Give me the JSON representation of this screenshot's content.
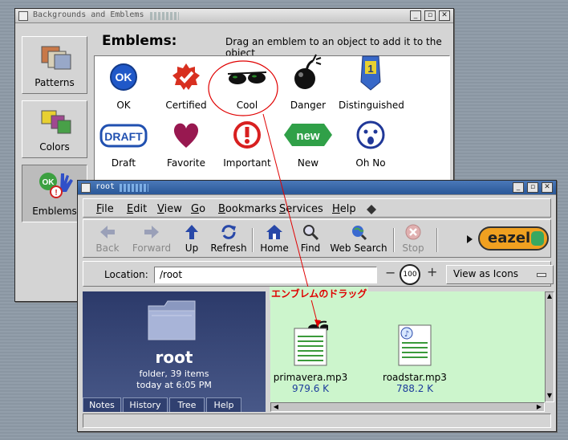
{
  "bg_window": {
    "title": "Backgrounds and Emblems",
    "header_title": "Emblems:",
    "header_hint": "Drag an emblem to an object to add it to the object",
    "sidebar": [
      {
        "label": "Patterns",
        "icon": "patterns-icon"
      },
      {
        "label": "Colors",
        "icon": "colors-icon"
      },
      {
        "label": "Emblems",
        "icon": "emblems-icon"
      }
    ],
    "emblems": [
      {
        "label": "OK",
        "icon": "ok-icon"
      },
      {
        "label": "Certified",
        "icon": "certified-icon"
      },
      {
        "label": "Cool",
        "icon": "sunglasses-icon"
      },
      {
        "label": "Danger",
        "icon": "bomb-icon"
      },
      {
        "label": "Distinguished",
        "icon": "ribbon-icon"
      },
      {
        "label": "Draft",
        "icon": "draft-icon"
      },
      {
        "label": "Favorite",
        "icon": "heart-icon"
      },
      {
        "label": "Important",
        "icon": "important-icon"
      },
      {
        "label": "New",
        "icon": "new-icon"
      },
      {
        "label": "Oh No",
        "icon": "oh-no-icon"
      }
    ]
  },
  "root_window": {
    "title": "root",
    "menu": [
      "File",
      "Edit",
      "View",
      "Go",
      "Bookmarks",
      "Services",
      "Help"
    ],
    "menu_underline": [
      "F",
      "E",
      "V",
      "G",
      "B",
      "S",
      "H"
    ],
    "toolbar": [
      {
        "label": "Back",
        "icon": "back-arrow-icon",
        "enabled": false
      },
      {
        "label": "Forward",
        "icon": "forward-arrow-icon",
        "enabled": false
      },
      {
        "label": "Up",
        "icon": "up-arrow-icon",
        "enabled": true
      },
      {
        "label": "Refresh",
        "icon": "refresh-icon",
        "enabled": true
      },
      {
        "label": "Home",
        "icon": "home-icon",
        "enabled": true
      },
      {
        "label": "Find",
        "icon": "find-icon",
        "enabled": true
      },
      {
        "label": "Web Search",
        "icon": "web-search-icon",
        "enabled": true
      },
      {
        "label": "Stop",
        "icon": "stop-icon",
        "enabled": false
      }
    ],
    "brand_logo": "eazel",
    "location_label": "Location:",
    "location_value": "/root",
    "zoom_value": "100",
    "view_mode": "View as Icons",
    "sidebar": {
      "folder_name": "root",
      "info_line1": "folder, 39 items",
      "info_line2": "today at 6:05 PM",
      "tabs": [
        "Notes",
        "History",
        "Tree",
        "Help"
      ]
    },
    "files": [
      {
        "name": "primavera.mp3",
        "size": "979.6 K"
      },
      {
        "name": "roadstar.mp3",
        "size": "788.2 K"
      }
    ]
  },
  "annotation": "エンブレムのドラッグ",
  "colors": {
    "accent_red": "#e00000",
    "content_bg": "#ccf5cc",
    "sidebar_bg": "#2c3a6a",
    "eazel_orange": "#f0a020"
  }
}
